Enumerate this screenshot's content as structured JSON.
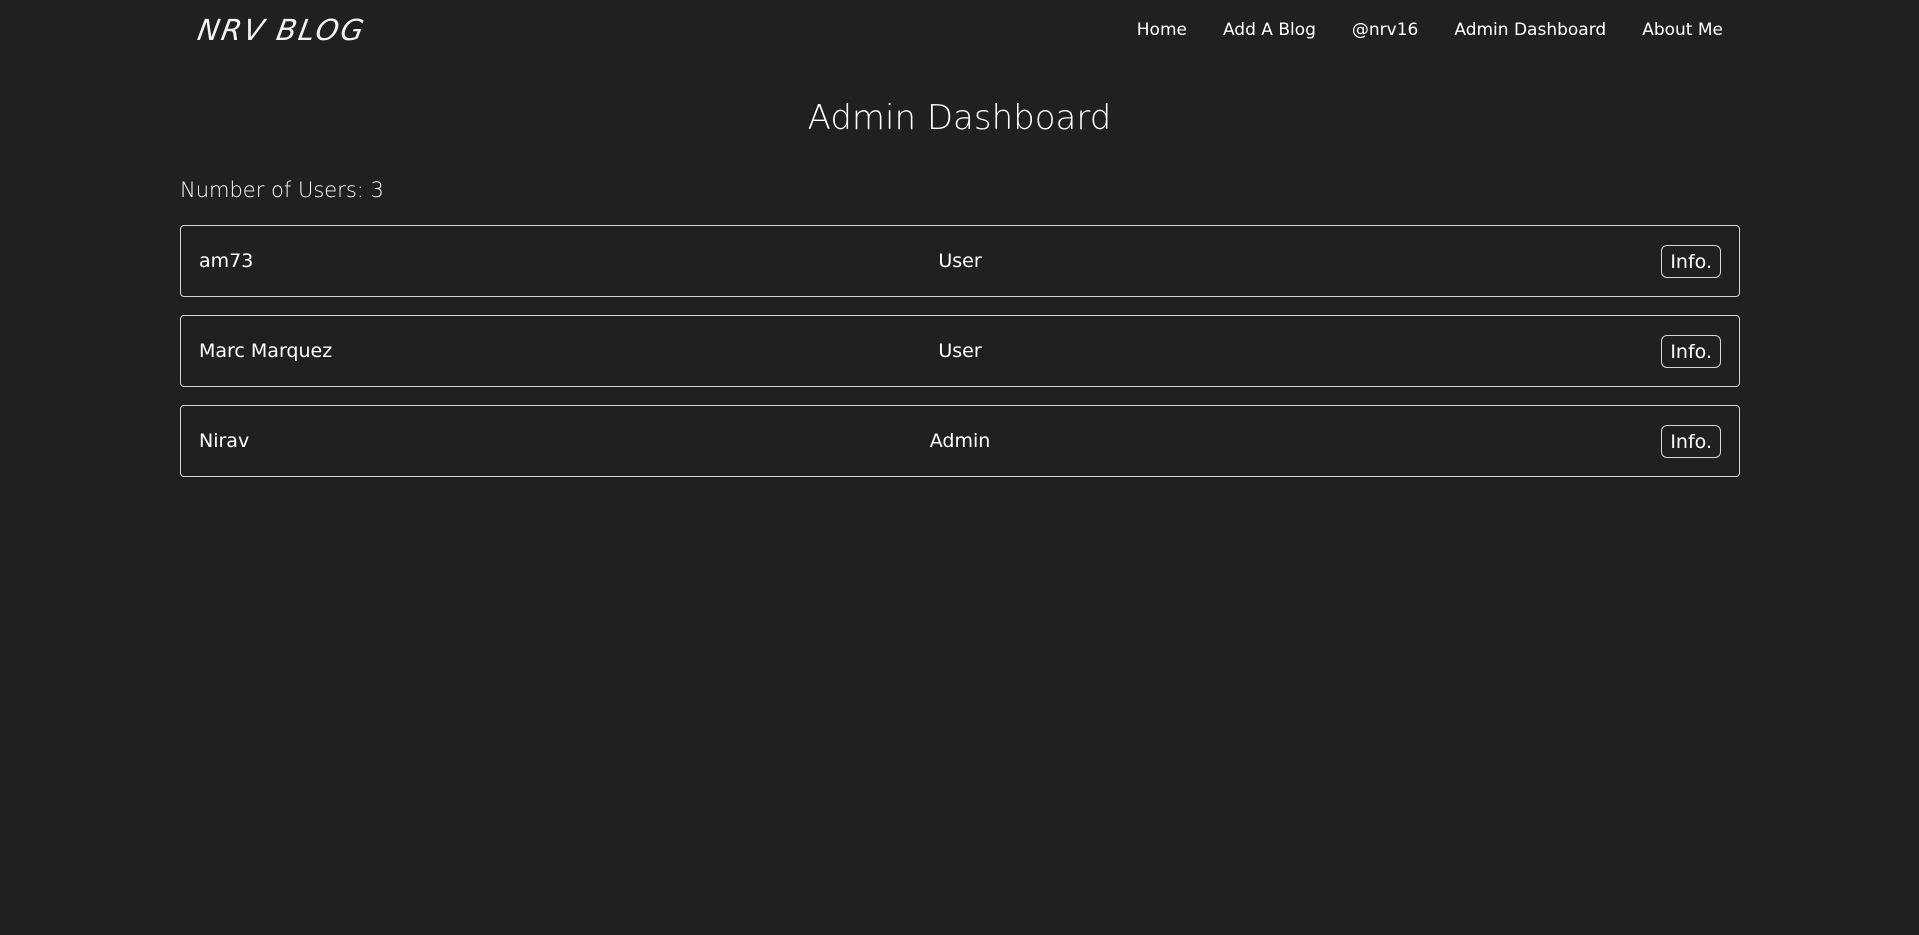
{
  "navbar": {
    "brand": "NRV BLOG",
    "links": [
      {
        "label": "Home"
      },
      {
        "label": "Add A Blog"
      },
      {
        "label": "@nrv16"
      },
      {
        "label": "Admin Dashboard"
      },
      {
        "label": "About Me"
      }
    ]
  },
  "main": {
    "title": "Admin Dashboard",
    "user_count": "Number of Users: 3",
    "users": [
      {
        "name": "am73",
        "role": "User",
        "button": "Info."
      },
      {
        "name": "Marc Marquez",
        "role": "User",
        "button": "Info."
      },
      {
        "name": "Nirav",
        "role": "Admin",
        "button": "Info."
      }
    ]
  },
  "colors": {
    "background": "#1f201f",
    "text": "#ffffff",
    "border": "#d6d6d6"
  }
}
